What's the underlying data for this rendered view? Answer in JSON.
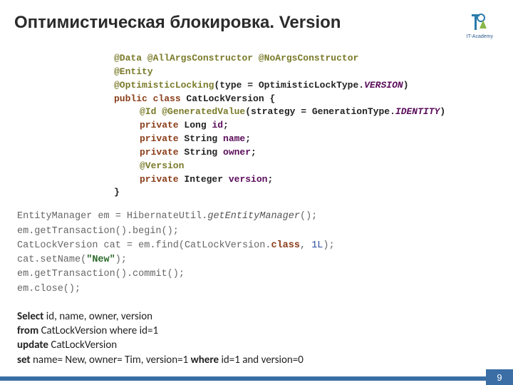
{
  "title": "Оптимистическая блокировка. Version",
  "logo": {
    "label": "IT-Academy"
  },
  "code1": {
    "l1a": "@Data",
    "l1b": "@AllArgsConstructor",
    "l1c": "@NoArgsConstructor",
    "l2": "@Entity",
    "l3a": "@OptimisticLocking",
    "l3b": "(type = OptimisticLockType.",
    "l3c": "VERSION",
    "l3d": ")",
    "l4a": "public class ",
    "l4b": "CatLockVersion {",
    "l5a": "@Id",
    "l5b": "@GeneratedValue",
    "l5c": "(strategy = GenerationType.",
    "l5d": "IDENTITY",
    "l5e": ")",
    "l6a": "private ",
    "l6b": "Long ",
    "l6c": "id",
    "l6d": ";",
    "l7a": "private ",
    "l7b": "String ",
    "l7c": "name",
    "l7d": ";",
    "l8a": "private ",
    "l8b": "String ",
    "l8c": "owner",
    "l8d": ";",
    "l9": "@Version",
    "l10a": "private ",
    "l10b": "Integer ",
    "l10c": "version",
    "l10d": ";",
    "l11": "}"
  },
  "code2": {
    "l1a": "EntityManager em = HibernateUtil.",
    "l1b": "getEntityManager",
    "l1c": "();",
    "l2": "em.getTransaction().begin();",
    "l3a": "CatLockVersion cat = em.find(CatLockVersion.",
    "l3b": "class",
    "l3c": ", ",
    "l3d": "1L",
    "l3e": ");",
    "l4a": "cat.setName(",
    "l4b": "\"New\"",
    "l4c": ");",
    "l5": "em.getTransaction().commit();",
    "l6": "em.close();"
  },
  "sql": {
    "l1a": "Select",
    "l1b": " id, name, owner, version",
    "l2a": "from",
    "l2b": " CatLockVersion  where id=1",
    "l3a": "update",
    "l3b": " CatLockVersion",
    "l4a": "set",
    "l4b": " name= New, owner= Tim, version=1 ",
    "l4c": "where",
    "l4d": " id=1 and version=0"
  },
  "page_number": "9"
}
